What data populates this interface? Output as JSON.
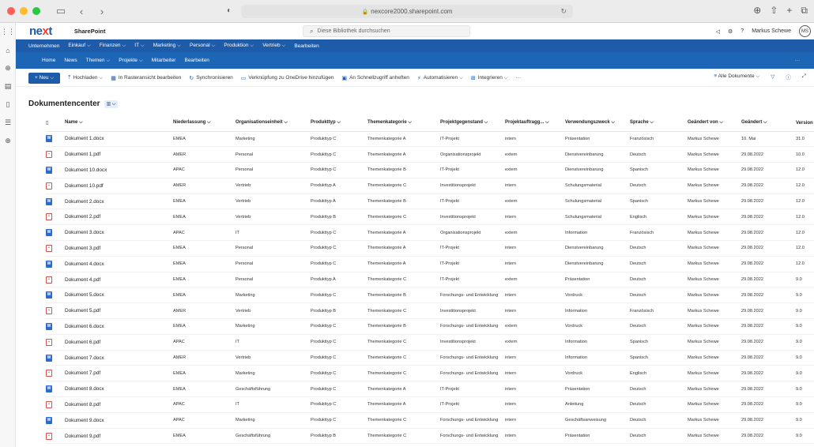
{
  "browser": {
    "url": "nexcore2000.sharepoint.com"
  },
  "suite": {
    "logo_a": "ne",
    "logo_b": "x",
    "logo_c": "t",
    "brand": "SharePoint",
    "search_placeholder": "Diese Bibliothek durchsuchen",
    "user": "Markus Schewe",
    "initials": "MS"
  },
  "nav1": [
    "Unternehmen",
    "Einkauf ⌵",
    "Finanzen ⌵",
    "IT ⌵",
    "Marketing ⌵",
    "Personal ⌵",
    "Produktion ⌵",
    "Vertrieb ⌵",
    "Bearbeiten"
  ],
  "nav2": [
    "Home",
    "News",
    "Themen ⌵",
    "Projekte ⌵",
    "Mitarbeiter",
    "Bearbeiten"
  ],
  "cmd": {
    "new": "+ Neu ⌵",
    "items": [
      "Hochladen ⌵",
      "In Rasteransicht bearbeiten",
      "Synchronisieren",
      "Verknüpfung zu OneDrive hinzufügen",
      "An Schnellzugriff anheften",
      "Automatisieren ⌵",
      "Integrieren ⌵",
      "···"
    ],
    "view": "Alle Dokumente ⌵"
  },
  "title": "Dokumentencenter",
  "columns": [
    "Name ⌵",
    "Niederlassung ⌵",
    "Organisationseinheit ⌵",
    "Produkttyp ⌵",
    "Themenkategorie ⌵",
    "Projektgegenstand ⌵",
    "Projektauftragg... ⌵",
    "Verwendungszweck ⌵",
    "Sprache ⌵",
    "Geändert von ⌵",
    "Geändert ⌵",
    "Version"
  ],
  "rows": [
    {
      "type": "docx",
      "c": [
        "Dokument 1.docx",
        "EMEA",
        "Marketing",
        "Produkttyp C",
        "Themenkategorie A",
        "IT-Projekt",
        "intern",
        "Präsentation",
        "Französisch",
        "Markus Schewe",
        "10. Mai",
        "31.0"
      ]
    },
    {
      "type": "pdf",
      "c": [
        "Dokument 1.pdf",
        "AMER",
        "Personal",
        "Produkttyp C",
        "Themenkategorie A",
        "Organisationsprojekt",
        "extern",
        "Dienstvereinbarung",
        "Deutsch",
        "Markus Schewe",
        "29.08.2022",
        "10.0"
      ]
    },
    {
      "type": "docx",
      "c": [
        "Dokument 10.docx",
        "APAC",
        "Personal",
        "Produkttyp C",
        "Themenkategorie B",
        "IT-Projekt",
        "extern",
        "Dienstvereinbarung",
        "Spanisch",
        "Markus Schewe",
        "29.08.2022",
        "12.0"
      ]
    },
    {
      "type": "pdf",
      "c": [
        "Dokument 10.pdf",
        "AMER",
        "Vertrieb",
        "Produkttyp A",
        "Themenkategorie C",
        "Investitionsprojekt",
        "intern",
        "Schulungsmaterial",
        "Deutsch",
        "Markus Schewe",
        "29.08.2022",
        "12.0"
      ]
    },
    {
      "type": "docx",
      "c": [
        "Dokument 2.docx",
        "EMEA",
        "Vertrieb",
        "Produkttyp A",
        "Themenkategorie B",
        "IT-Projekt",
        "extern",
        "Schulungsmaterial",
        "Spanisch",
        "Markus Schewe",
        "29.08.2022",
        "12.0"
      ]
    },
    {
      "type": "pdf",
      "c": [
        "Dokument 2.pdf",
        "EMEA",
        "Vertrieb",
        "Produkttyp B",
        "Themenkategorie C",
        "Investitionsprojekt",
        "intern",
        "Schulungsmaterial",
        "Englisch",
        "Markus Schewe",
        "29.08.2022",
        "12.0"
      ]
    },
    {
      "type": "docx",
      "c": [
        "Dokument 3.docx",
        "APAC",
        "IT",
        "Produkttyp C",
        "Themenkategorie A",
        "Organisationsprojekt",
        "extern",
        "Information",
        "Französisch",
        "Markus Schewe",
        "29.08.2022",
        "12.0"
      ]
    },
    {
      "type": "pdf",
      "c": [
        "Dokument 3.pdf",
        "EMEA",
        "Personal",
        "Produkttyp C",
        "Themenkategorie A",
        "IT-Projekt",
        "intern",
        "Dienstvereinbarung",
        "Deutsch",
        "Markus Schewe",
        "29.08.2022",
        "12.0"
      ]
    },
    {
      "type": "docx",
      "c": [
        "Dokument 4.docx",
        "EMEA",
        "Personal",
        "Produkttyp C",
        "Themenkategorie A",
        "IT-Projekt",
        "intern",
        "Dienstvereinbarung",
        "Deutsch",
        "Markus Schewe",
        "29.08.2022",
        "12.0"
      ]
    },
    {
      "type": "pdf",
      "c": [
        "Dokument 4.pdf",
        "EMEA",
        "Personal",
        "Produkttyp A",
        "Themenkategorie C",
        "IT-Projekt",
        "extern",
        "Präsentation",
        "Deutsch",
        "Markus Schewe",
        "29.08.2022",
        "9.0"
      ]
    },
    {
      "type": "docx",
      "c": [
        "Dokument 5.docx",
        "EMEA",
        "Marketing",
        "Produkttyp C",
        "Themenkategorie B",
        "Forschungs- und Entwicklung",
        "intern",
        "Vordruck",
        "Deutsch",
        "Markus Schewe",
        "29.08.2022",
        "9.0"
      ]
    },
    {
      "type": "pdf",
      "c": [
        "Dokument 5.pdf",
        "AMER",
        "Vertrieb",
        "Produkttyp B",
        "Themenkategorie C",
        "Investitionsprojekt",
        "intern",
        "Information",
        "Französisch",
        "Markus Schewe",
        "29.08.2022",
        "9.0"
      ]
    },
    {
      "type": "docx",
      "c": [
        "Dokument 6.docx",
        "EMEA",
        "Marketing",
        "Produkttyp C",
        "Themenkategorie B",
        "Forschungs- und Entwicklung",
        "extern",
        "Vordruck",
        "Deutsch",
        "Markus Schewe",
        "29.08.2022",
        "9.0"
      ]
    },
    {
      "type": "pdf",
      "c": [
        "Dokument 6.pdf",
        "APAC",
        "IT",
        "Produkttyp C",
        "Themenkategorie C",
        "Investitionsprojekt",
        "extern",
        "Information",
        "Spanisch",
        "Markus Schewe",
        "29.08.2022",
        "9.0"
      ]
    },
    {
      "type": "docx",
      "c": [
        "Dokument 7.docx",
        "AMER",
        "Vertrieb",
        "Produkttyp C",
        "Themenkategorie C",
        "Forschungs- und Entwicklung",
        "intern",
        "Information",
        "Spanisch",
        "Markus Schewe",
        "29.08.2022",
        "9.0"
      ]
    },
    {
      "type": "pdf",
      "c": [
        "Dokument 7.pdf",
        "EMEA",
        "Marketing",
        "Produkttyp C",
        "Themenkategorie C",
        "Forschungs- und Entwicklung",
        "intern",
        "Vordruck",
        "Englisch",
        "Markus Schewe",
        "29.08.2022",
        "9.0"
      ]
    },
    {
      "type": "docx",
      "c": [
        "Dokument 8.docx",
        "EMEA",
        "Geschäftsführung",
        "Produkttyp C",
        "Themenkategorie A",
        "IT-Projekt",
        "intern",
        "Präsentation",
        "Deutsch",
        "Markus Schewe",
        "29.08.2022",
        "9.0"
      ]
    },
    {
      "type": "pdf",
      "c": [
        "Dokument 8.pdf",
        "APAC",
        "IT",
        "Produkttyp C",
        "Themenkategorie A",
        "IT-Projekt",
        "intern",
        "Anleitung",
        "Deutsch",
        "Markus Schewe",
        "29.08.2022",
        "9.0"
      ]
    },
    {
      "type": "docx",
      "c": [
        "Dokument 9.docx",
        "APAC",
        "Marketing",
        "Produkttyp C",
        "Themenkategorie C",
        "Forschungs- und Entwicklung",
        "intern",
        "Geschäftsanweisung",
        "Deutsch",
        "Markus Schewe",
        "29.08.2022",
        "9.0"
      ]
    },
    {
      "type": "pdf",
      "c": [
        "Dokument 9.pdf",
        "EMEA",
        "Geschäftsführung",
        "Produkttyp B",
        "Themenkategorie C",
        "Forschungs- und Entwicklung",
        "intern",
        "Präsentation",
        "Deutsch",
        "Markus Schewe",
        "29.08.2022",
        "9.0"
      ]
    }
  ]
}
